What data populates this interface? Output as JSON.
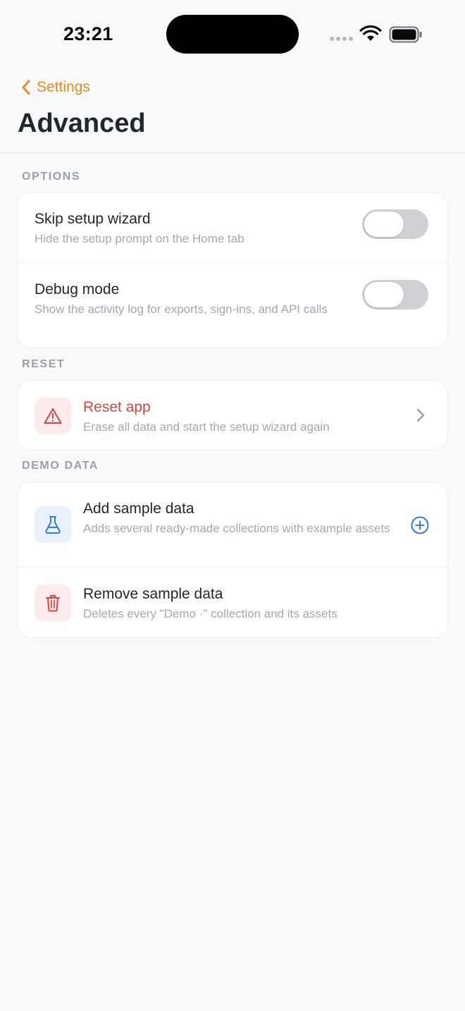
{
  "status_bar": {
    "time": "23:21"
  },
  "header": {
    "back_label": "Settings",
    "title": "Advanced"
  },
  "sections": {
    "options": {
      "label": "OPTIONS",
      "skip_wizard": {
        "title": "Skip setup wizard",
        "subtitle": "Hide the setup prompt on the Home tab",
        "enabled": false
      },
      "debug_mode": {
        "title": "Debug mode",
        "subtitle": "Show the activity log for exports, sign-ins, and API calls",
        "enabled": false
      }
    },
    "reset": {
      "label": "RESET",
      "reset_app": {
        "title": "Reset app",
        "subtitle": "Erase all data and start the setup wizard again"
      }
    },
    "demo": {
      "label": "DEMO DATA",
      "add_sample": {
        "title": "Add sample data",
        "subtitle": "Adds several ready-made collections with example assets"
      },
      "remove_sample": {
        "title": "Remove sample data",
        "subtitle": "Deletes every \"Demo ·\" collection and its assets"
      }
    }
  },
  "colors": {
    "accent": "#ef8a16",
    "danger": "#d9453e",
    "link": "#2f7fe0"
  }
}
